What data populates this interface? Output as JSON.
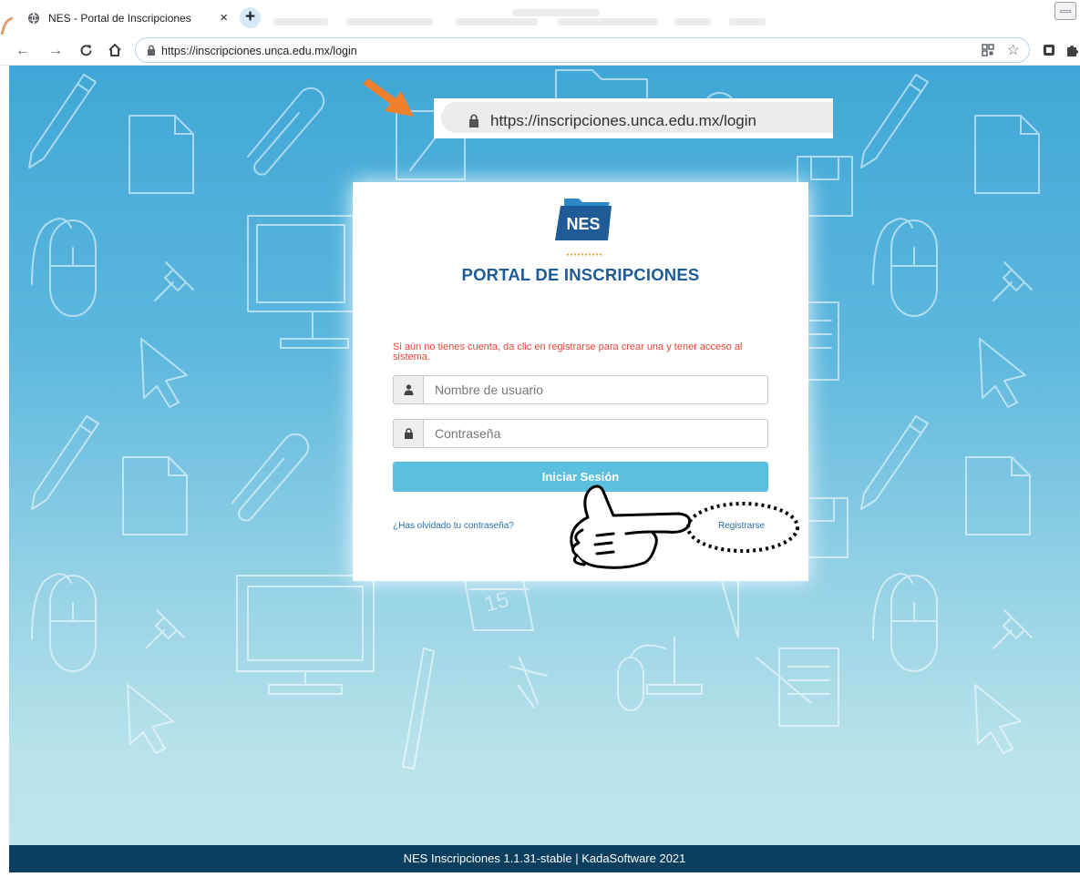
{
  "browser": {
    "tab_title": "NES - Portal de Inscripciones",
    "tab_close": "×",
    "new_tab": "+",
    "address": "https://inscripciones.unca.edu.mx/login",
    "icons": [
      "back-icon",
      "forward-icon",
      "reload-icon",
      "home-icon",
      "lock-icon",
      "qr-icon",
      "star-icon",
      "extension-icon",
      "puzzle-icon"
    ]
  },
  "zoom_callout": {
    "address": "https://inscripciones.unca.edu.mx/login"
  },
  "login": {
    "logo_text": "NES",
    "title": "PORTAL DE INSCRIPCIONES",
    "notice": "Si aún no tienes cuenta, da clic en registrarse para crear una y tener acceso al sistema.",
    "username_placeholder": "Nombre de usuario",
    "password_placeholder": "Contraseña",
    "submit_label": "Iniciar Sesión",
    "forgot_label": "¿Has olvidado tu contraseña?",
    "register_label": "Registrarse"
  },
  "footer": {
    "text": "NES Inscripciones 1.1.31-stable | KadaSoftware 2021"
  },
  "colors": {
    "background_top": "#3fa7d6",
    "background_bottom": "#bfe6ec",
    "brand_blue": "#1f5b96",
    "button": "#5bc0de",
    "notice": "#e6463a",
    "footer": "#0b3f5f",
    "callout_arrow": "#f07f2c"
  }
}
